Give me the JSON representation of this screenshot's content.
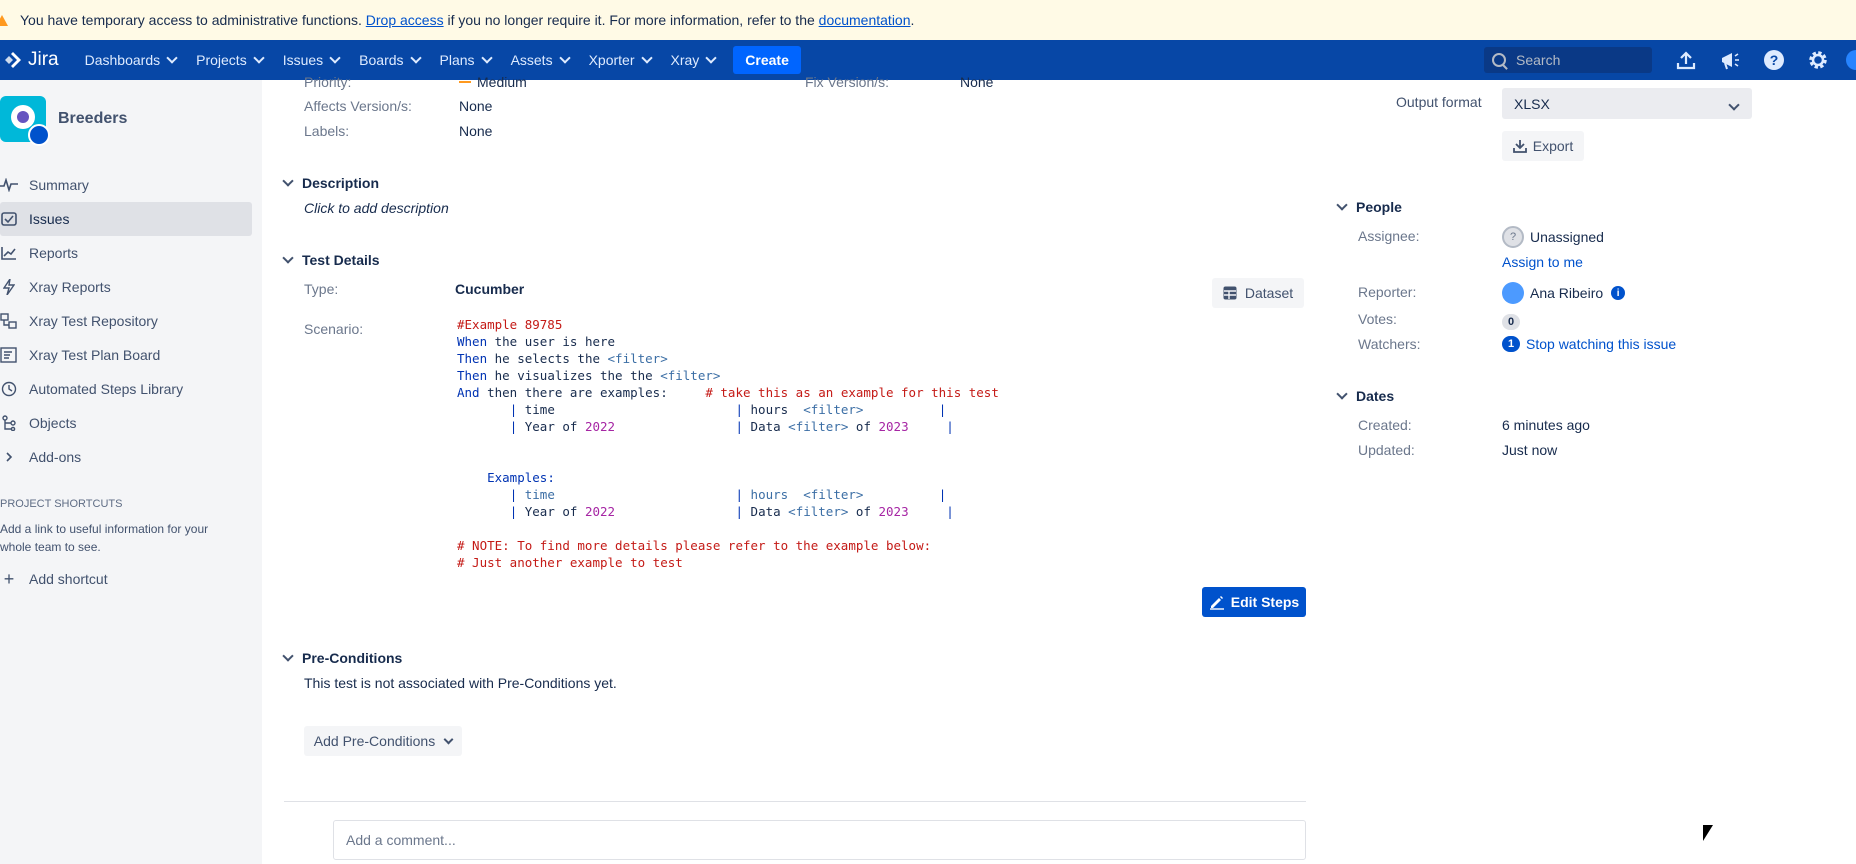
{
  "banner": {
    "text_before": "You have temporary access to administrative functions.",
    "drop_link": "Drop access",
    "text_middle": "if you no longer require it. For more information, refer to the",
    "doc_link": "documentation",
    "text_after": "."
  },
  "topnav": {
    "logo": "Jira",
    "items": [
      "Dashboards",
      "Projects",
      "Issues",
      "Boards",
      "Plans",
      "Assets",
      "Xporter",
      "Xray"
    ],
    "create": "Create",
    "search_placeholder": "Search",
    "icons": [
      "upload-icon",
      "megaphone-icon",
      "help-icon",
      "settings-icon"
    ]
  },
  "sidebar": {
    "project_name": "Breeders",
    "items": [
      {
        "label": "Summary",
        "icon": "pulse-icon"
      },
      {
        "label": "Issues",
        "icon": "issues-icon",
        "active": true
      },
      {
        "label": "Reports",
        "icon": "chart-icon"
      },
      {
        "label": "Xray Reports",
        "icon": "lightning-icon"
      },
      {
        "label": "Xray Test Repository",
        "icon": "repository-icon"
      },
      {
        "label": "Xray Test Plan Board",
        "icon": "board-icon"
      },
      {
        "label": "Automated Steps Library",
        "icon": "library-icon"
      },
      {
        "label": "Objects",
        "icon": "tree-icon"
      },
      {
        "label": "Add-ons",
        "icon": "chevron-right-icon"
      }
    ],
    "shortcuts_title": "PROJECT SHORTCUTS",
    "shortcuts_text": "Add a link to useful information for your whole team to see.",
    "add_shortcut": "Add shortcut"
  },
  "details": {
    "priority_label": "Priority:",
    "priority_value": "Medium",
    "fix_label": "Fix Version/s:",
    "fix_value": "None",
    "affects_label": "Affects Version/s:",
    "affects_value": "None",
    "labels_label": "Labels:",
    "labels_value": "None"
  },
  "description": {
    "title": "Description",
    "placeholder": "Click to add description"
  },
  "test_details": {
    "title": "Test Details",
    "type_label": "Type:",
    "type_value": "Cucumber",
    "dataset_button": "Dataset",
    "scenario_label": "Scenario:",
    "edit_steps": "Edit Steps"
  },
  "preconditions": {
    "title": "Pre-Conditions",
    "text": "This test is not associated with Pre-Conditions yet.",
    "add_button": "Add Pre-Conditions"
  },
  "comment": {
    "placeholder": "Add a comment..."
  },
  "export": {
    "output_label": "Output format",
    "output_value": "XLSX",
    "export_button": "Export"
  },
  "people": {
    "title": "People",
    "assignee_label": "Assignee:",
    "assignee_value": "Unassigned",
    "assign_me": "Assign to me",
    "reporter_label": "Reporter:",
    "reporter_value": "Ana Ribeiro",
    "votes_label": "Votes:",
    "votes_value": "0",
    "watchers_label": "Watchers:",
    "watchers_count": "1",
    "watchers_link": "Stop watching this issue"
  },
  "dates": {
    "title": "Dates",
    "created_label": "Created:",
    "created_value": "6 minutes ago",
    "updated_label": "Updated:",
    "updated_value": "Just now"
  },
  "colors": {
    "nav": "#0747a6",
    "banner": "#fffae6",
    "link": "#0052cc",
    "comment_red": "#c41a16"
  }
}
